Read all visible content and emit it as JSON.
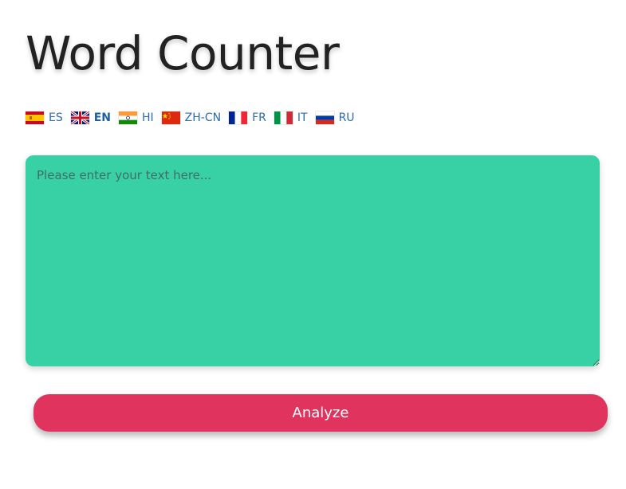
{
  "page": {
    "title": "Word Counter"
  },
  "languages": [
    {
      "code": "ES",
      "icon": "spain-flag-icon",
      "active": false
    },
    {
      "code": "EN",
      "icon": "uk-flag-icon",
      "active": true
    },
    {
      "code": "HI",
      "icon": "india-flag-icon",
      "active": false
    },
    {
      "code": "ZH-CN",
      "icon": "china-flag-icon",
      "active": false
    },
    {
      "code": "FR",
      "icon": "france-flag-icon",
      "active": false
    },
    {
      "code": "IT",
      "icon": "italy-flag-icon",
      "active": false
    },
    {
      "code": "RU",
      "icon": "russia-flag-icon",
      "active": false
    }
  ],
  "editor": {
    "placeholder": "Please enter your text here...",
    "value": ""
  },
  "actions": {
    "analyze_label": "Analyze"
  },
  "colors": {
    "textarea_bg": "#38d1a5",
    "button_bg": "#e0345f",
    "link": "#2b6cb0"
  }
}
